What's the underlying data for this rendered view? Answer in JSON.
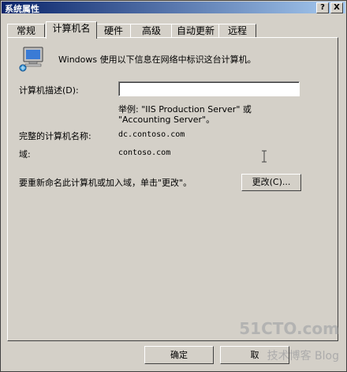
{
  "window": {
    "title": "系统属性",
    "help_glyph": "?",
    "close_glyph": "X"
  },
  "tabs": [
    {
      "label": "常规"
    },
    {
      "label": "计算机名"
    },
    {
      "label": "硬件"
    },
    {
      "label": "高级"
    },
    {
      "label": "自动更新"
    },
    {
      "label": "远程"
    }
  ],
  "active_tab": "计算机名",
  "panel": {
    "intro_icon": "computer-network-icon",
    "intro_text": "Windows 使用以下信息在网络中标识这台计算机。",
    "description_label": "计算机描述(D):",
    "description_value": "",
    "example_line1": "举例: \"IIS Production Server\" 或",
    "example_line2": "\"Accounting Server\"。",
    "full_name_label": "完整的计算机名称:",
    "full_name_value": "dc.contoso.com",
    "domain_label": "域:",
    "domain_value": "contoso.com",
    "rename_text": "要重新命名此计算机或加入域，单击\"更改\"。",
    "change_button": "更改(C)..."
  },
  "footer": {
    "ok_button": "确定",
    "cancel_button": "取"
  },
  "watermark": {
    "line1": "51CTO.com",
    "line2": "技术博客 Blog"
  }
}
